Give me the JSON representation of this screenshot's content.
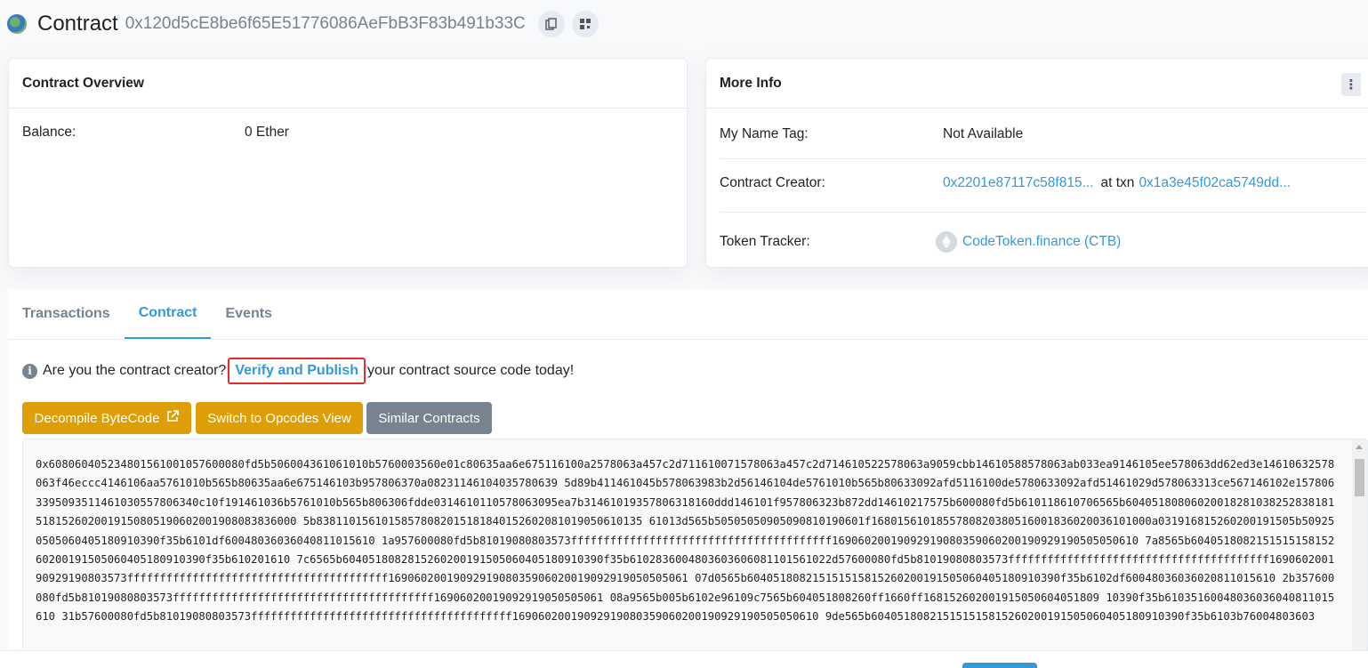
{
  "header": {
    "title": "Contract",
    "address": "0x120d5cE8be6f65E51776086AeFbB3F83b491b33C"
  },
  "overview": {
    "heading": "Contract Overview",
    "balance_label": "Balance:",
    "balance_value": "0 Ether"
  },
  "more_info": {
    "heading": "More Info",
    "name_tag_label": "My Name Tag:",
    "name_tag_value": "Not Available",
    "creator_label": "Contract Creator:",
    "creator_address": "0x2201e87117c58f815...",
    "at_txn": "at txn",
    "creator_txn": "0x1a3e45f02ca5749dd...",
    "token_label": "Token Tracker:",
    "token_value": "CodeToken.finance (CTB)"
  },
  "tabs": [
    {
      "label": "Transactions"
    },
    {
      "label": "Contract"
    },
    {
      "label": "Events"
    }
  ],
  "notice": {
    "pre": "Are you the contract creator?",
    "link": "Verify and Publish",
    "post": "your contract source code today!"
  },
  "buttons": {
    "decompile": "Decompile ByteCode",
    "opcodes": "Switch to Opcodes View",
    "similar": "Similar Contracts"
  },
  "bytecode": "0x608060405234801561001057600080fd5b506004361061010b5760003560e01c80635aa6e675116100a2578063a457c2d711610071578063a457c2d714610522578063a9059cbb14610588578063ab033ea9146105ee578063dd62ed3e14610632578063f46eccc4146106aa5761010b565b80635aa6e675146103b957806370a08231146104035780639 5d89b411461045b578063983b2d56146104de5761010b565b80633092afd5116100de5780633092afd51461029d578063313ce567146102e1578063395093511461030557806340c10f191461036b5761010b565b806306fdde0314610110578063095ea7b31461019357806318160ddd146101f957806323b872dd14610217575b600080fd5b610118610706565b604051808060200182810382528381815181526020019150805190602001908083836000 5b83811015610158578082015181840152602081019050610135 61013d565b50505050905090810190601f1680156101855780820380516001836020036101000a031916815260200191505b509250505060405180910390f35b6101df60048036036040811015610 1a957600080fd5b81019080803573ffffffffffffffffffffffffffffffffffffffff16906020019092919080359060200190929190505050610 7a8565b604051808215151515815260200191505060405180910390f35b610201610 7c6565b6040518082815260200191505060405180910390f35b6102836004803603606081101561022d57600080fd5b81019080803573ffffffffffffffffffffffffffffffffffffffff169060200190929190803573ffffffffffffffffffffffffffffffffffffffff1690602001909291908035906020019092919050505061 07d0565b604051808215151515815260200191505060405180910390f35b6102df60048036036020811015610 2b357600080fd5b81019080803573ffffffffffffffffffffffffffffffffffffffff16906020019092919050505061 08a9565b005b6102e96109c7565b604051808260ff1660ff168152602001915050604051809 10390f35b61035160048036036040811015610 31b57600080fd5b81019080803573ffffffffffffffffffffffffffffffffffffffff16906020019092919080359060200190929190505050610 9de565b604051808215151515815260200191505060405180910390f35b6103b76004803603"
}
